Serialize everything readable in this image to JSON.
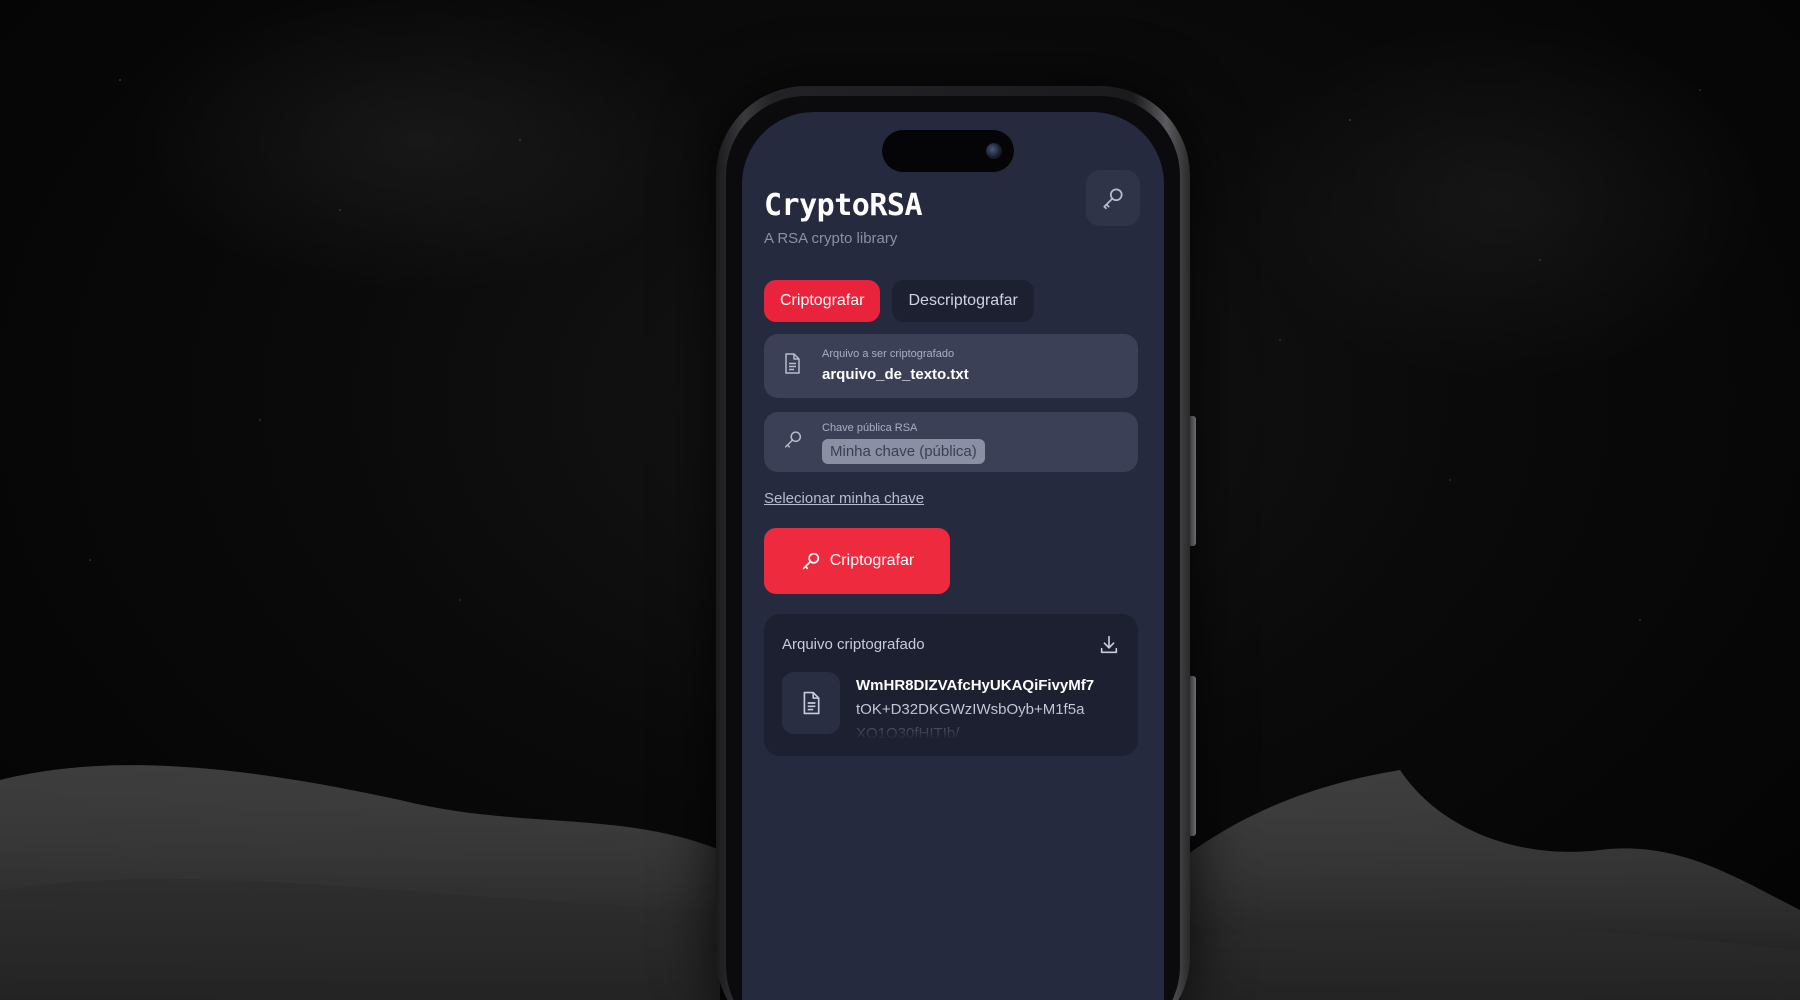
{
  "app": {
    "title": "CryptoRSA",
    "subtitle": "A RSA crypto library"
  },
  "header": {
    "key_button_icon": "key-icon"
  },
  "tabs": [
    {
      "label": "Criptografar",
      "active": true
    },
    {
      "label": "Descriptografar",
      "active": false
    }
  ],
  "file_field": {
    "icon": "document-icon",
    "label": "Arquivo a ser criptografado",
    "value": "arquivo_de_texto.txt"
  },
  "key_field": {
    "icon": "key-icon",
    "label": "Chave pública RSA",
    "selected_value": "Minha chave (pública)"
  },
  "select_key_link": "Selecionar minha chave",
  "encrypt_button": {
    "label": "Criptografar",
    "icon": "key-icon"
  },
  "result": {
    "title": "Arquivo criptografado",
    "download_icon": "download-icon",
    "file_icon": "document-icon",
    "lines": [
      "WmHR8DIZVAfcHyUKAQiFivyMf7",
      "tOK+D32DKGWzIWsbOyb+M1f5a",
      "XO1Q30fHITIb/"
    ]
  },
  "colors": {
    "accent": "#ee2a3f",
    "screen_background": "#262a3e",
    "field_background": "#3b4056",
    "card_background": "#1d2031"
  }
}
